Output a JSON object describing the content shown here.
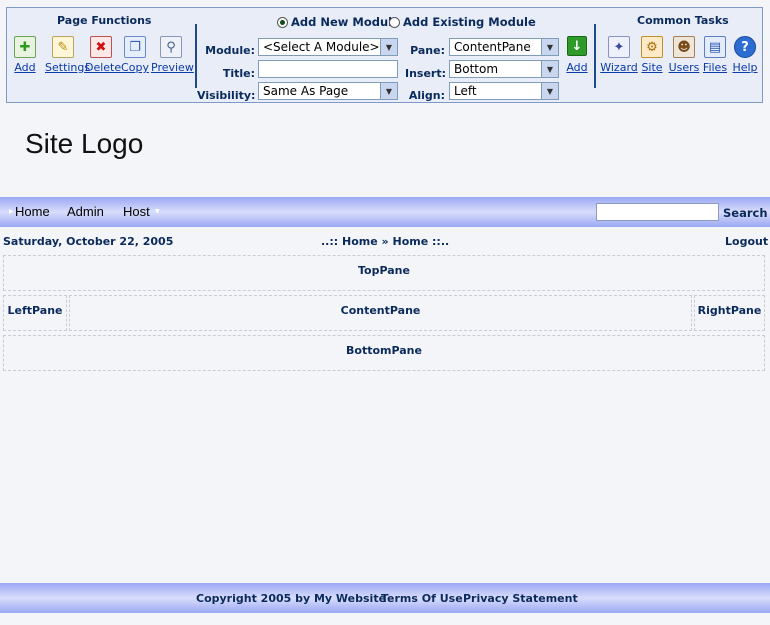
{
  "control_panel": {
    "page_functions_title": "Page Functions",
    "page_functions": [
      {
        "label": "Add",
        "icon": "add-icon"
      },
      {
        "label": "Settings",
        "icon": "settings-icon"
      },
      {
        "label": "Delete",
        "icon": "delete-icon"
      },
      {
        "label": "Copy",
        "icon": "copy-icon"
      },
      {
        "label": "Preview",
        "icon": "preview-icon"
      }
    ],
    "add_new_module_label": "Add New Module",
    "add_existing_module_label": "Add Existing Module",
    "module_label": "Module:",
    "module_value": "<Select A Module>",
    "title_label": "Title:",
    "title_value": "",
    "visibility_label": "Visibility:",
    "visibility_value": "Same As Page",
    "pane_label": "Pane:",
    "pane_value": "ContentPane",
    "insert_label": "Insert:",
    "insert_value": "Bottom",
    "align_label": "Align:",
    "align_value": "Left",
    "add_label": "Add",
    "common_tasks_title": "Common Tasks",
    "common_tasks": [
      {
        "label": "Wizard",
        "icon": "wizard-icon"
      },
      {
        "label": "Site",
        "icon": "site-icon"
      },
      {
        "label": "Users",
        "icon": "users-icon"
      },
      {
        "label": "Files",
        "icon": "files-icon"
      },
      {
        "label": "Help",
        "icon": "help-icon"
      }
    ]
  },
  "site": {
    "logo_text": "Site Logo"
  },
  "menu": {
    "items": [
      "Home",
      "Admin",
      "Host"
    ],
    "search_label": "Search",
    "search_value": ""
  },
  "info_bar": {
    "date": "Saturday, October 22, 2005",
    "breadcrumb_prefix": "..::",
    "breadcrumb_1": "Home",
    "breadcrumb_sep": "»",
    "breadcrumb_2": "Home",
    "breadcrumb_suffix": "::..",
    "logout": "Logout"
  },
  "panes": {
    "top": "TopPane",
    "left": "LeftPane",
    "content": "ContentPane",
    "right": "RightPane",
    "bottom": "BottomPane"
  },
  "footer": {
    "copyright": "Copyright 2005 by My Website",
    "terms": "Terms Of Use",
    "privacy": "Privacy Statement"
  },
  "colors": {
    "accent": "#0a2a5c",
    "menu_band": "#9aa8f3",
    "link": "#0a3aa8"
  }
}
